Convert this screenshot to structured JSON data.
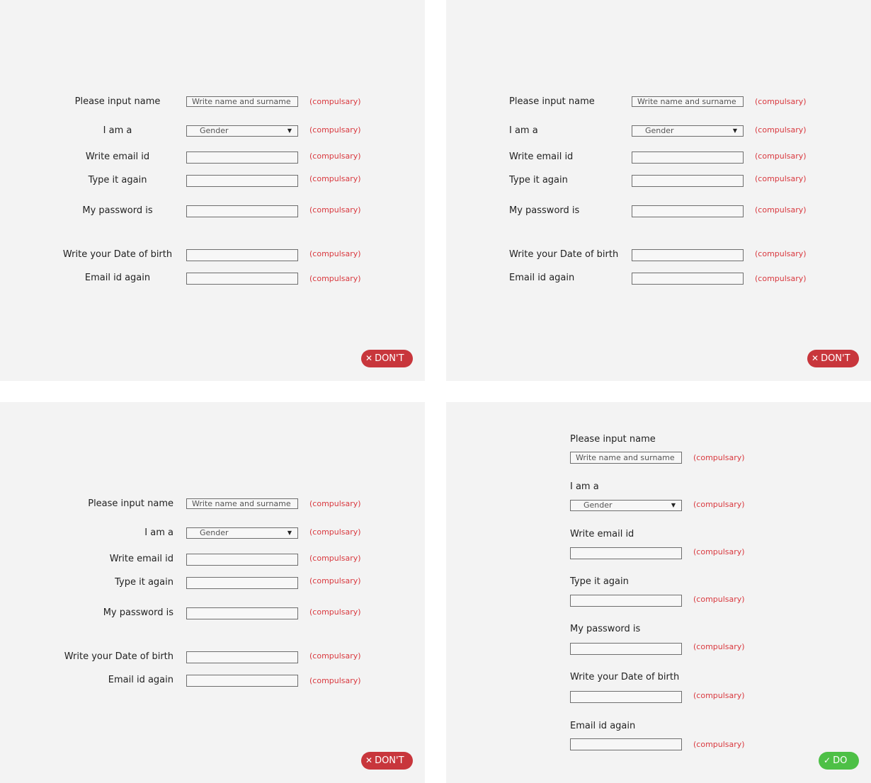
{
  "form": {
    "name_label": "Please input name",
    "name_placeholder": "Write name and surname",
    "gender_label": "I am a",
    "gender_value": "Gender",
    "email_label": "Write email id",
    "email_again_label": "Type it again",
    "password_label": "My password is",
    "dob_label": "Write your Date of birth",
    "email_id_again_label": "Email id again",
    "required_text": "(compulsary)"
  },
  "badges": {
    "dont": "DON'T",
    "do": "DO"
  },
  "icons": {
    "dont": "close-icon",
    "do": "check-icon",
    "select": "dropdown-arrow-icon"
  },
  "colors": {
    "panel": "#f3f3f3",
    "required": "#d9383e",
    "dont_badge": "#c8363c",
    "do_badge": "#4dc046"
  }
}
